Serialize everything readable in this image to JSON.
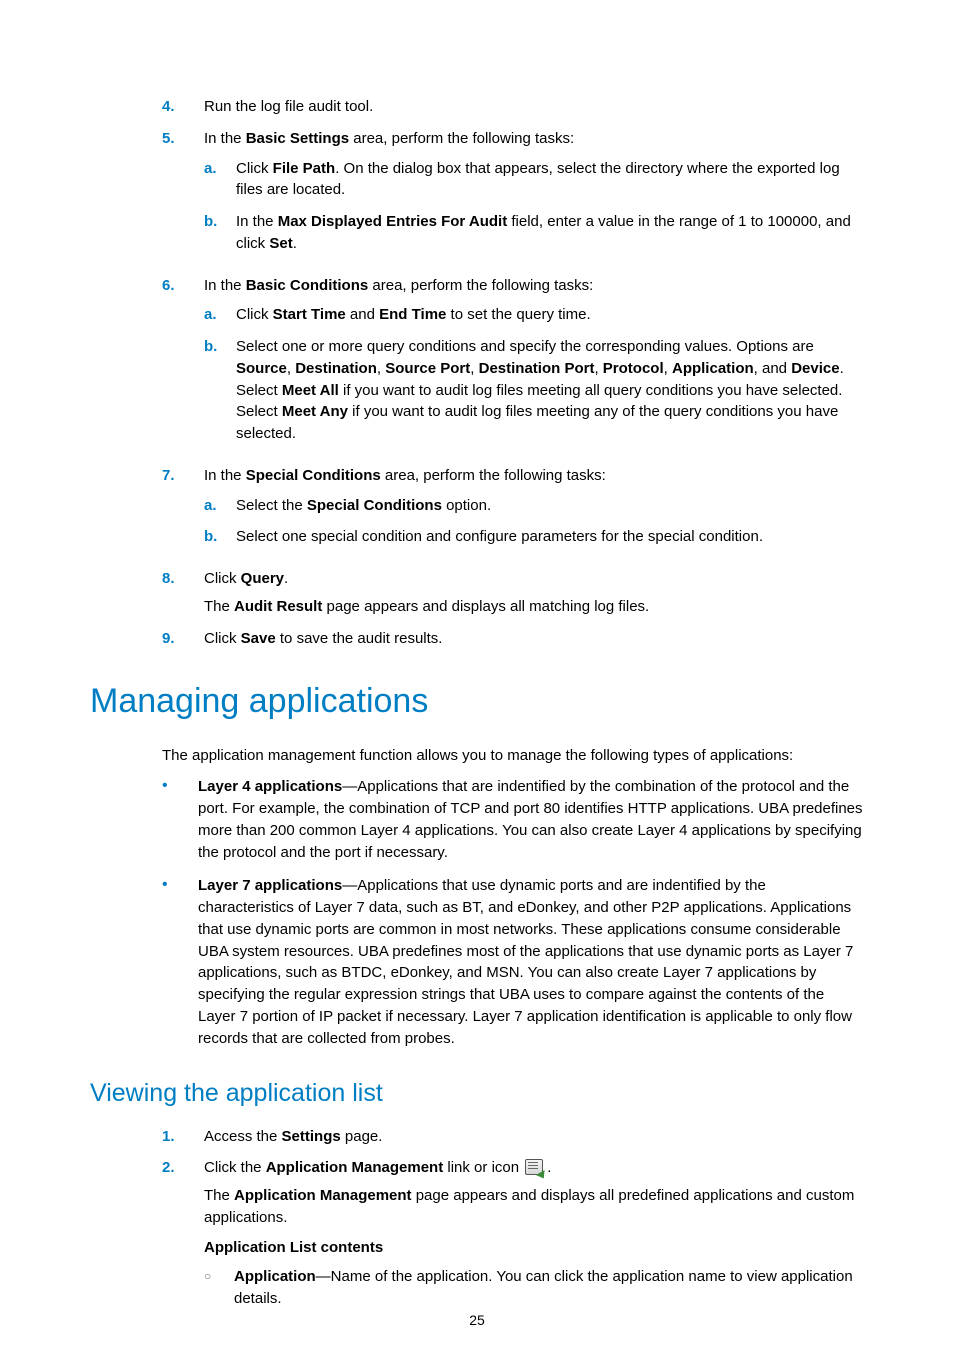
{
  "page_number": "25",
  "steps_top": {
    "s4": {
      "num": "4.",
      "text": "Run the log file audit tool."
    },
    "s5": {
      "num": "5.",
      "lead_pre": "In the ",
      "lead_bold": "Basic Settings",
      "lead_post": " area, perform the following tasks:",
      "a": {
        "mk": "a.",
        "pre": "Click ",
        "b1": "File Path",
        "post": ". On the dialog box that appears, select the directory where the exported log files are located."
      },
      "b": {
        "mk": "b.",
        "pre": "In the ",
        "b1": "Max Displayed Entries For Audit",
        "mid": " field, enter a value in the range of 1 to 100000, and click ",
        "b2": "Set",
        "post": "."
      }
    },
    "s6": {
      "num": "6.",
      "lead_pre": "In the ",
      "lead_bold": "Basic Conditions",
      "lead_post": " area, perform the following tasks:",
      "a": {
        "mk": "a.",
        "pre": "Click ",
        "b1": "Start Time",
        "mid": " and ",
        "b2": "End Time",
        "post": " to set the query time."
      },
      "b": {
        "mk": "b.",
        "t0": "Select one or more query conditions and specify the corresponding values. Options are ",
        "src": "Source",
        "c1": ", ",
        "dst": "Destination",
        "c2": ", ",
        "sp": "Source Port",
        "c3": ", ",
        "dp": "Destination Port",
        "c4": ", ",
        "proto": "Protocol",
        "c5": ", ",
        "app": "Application",
        "c6": ", and ",
        "dev": "Device",
        "t1": ". Select ",
        "ma": "Meet All",
        "t2": " if you want to audit log files meeting all query conditions you have selected. Select ",
        "many": "Meet Any",
        "t3": " if you want to audit log files meeting any of the query conditions you have selected."
      }
    },
    "s7": {
      "num": "7.",
      "lead_pre": "In the ",
      "lead_bold": "Special Conditions",
      "lead_post": " area, perform the following tasks:",
      "a": {
        "mk": "a.",
        "pre": "Select the ",
        "b1": "Special Conditions",
        "post": " option."
      },
      "b": {
        "mk": "b.",
        "text": "Select one special condition and configure parameters for the special condition."
      }
    },
    "s8": {
      "num": "8.",
      "pre": "Click ",
      "b1": "Query",
      "post": ".",
      "result_pre": "The ",
      "result_b": "Audit Result",
      "result_post": " page appears and displays all matching log files."
    },
    "s9": {
      "num": "9.",
      "pre": "Click ",
      "b1": "Save",
      "post": " to save the audit results."
    }
  },
  "h1": "Managing applications",
  "intro": "The application management function allows you to manage the following types of applications:",
  "bul": {
    "l4": {
      "b": "Layer 4 applications",
      "text": "—Applications that are indentified by the combination of the protocol and the port. For example, the combination of TCP and port 80 identifies HTTP applications. UBA predefines more than 200 common Layer 4 applications. You can also create Layer 4 applications by specifying the protocol and the port if necessary."
    },
    "l7": {
      "b": "Layer 7 applications",
      "text": "—Applications that use dynamic ports and are indentified by the characteristics of Layer 7 data, such as BT, and eDonkey, and other P2P applications. Applications that use dynamic ports are common in most networks. These applications consume considerable UBA system resources. UBA predefines most of the applications that use dynamic ports as Layer 7 applications, such as BTDC, eDonkey, and MSN. You can also create Layer 7 applications by specifying the regular expression strings that UBA uses to compare against the contents of the Layer 7 portion of IP packet if necessary. Layer 7 application identification is applicable to only flow records that are collected from probes."
    }
  },
  "h2": "Viewing the application list",
  "view": {
    "s1": {
      "num": "1.",
      "pre": "Access the ",
      "b1": "Settings",
      "post": " page."
    },
    "s2": {
      "num": "2.",
      "pre": "Click the ",
      "b1": "Application Management",
      "mid": " link or icon ",
      "post": ".",
      "result_pre": "The ",
      "result_b": "Application Management",
      "result_post": " page appears and displays all predefined applications and custom applications.",
      "list_title": "Application List contents",
      "app_item_b": "Application",
      "app_item_text": "—Name of the application. You can click the application name to view application details."
    }
  }
}
